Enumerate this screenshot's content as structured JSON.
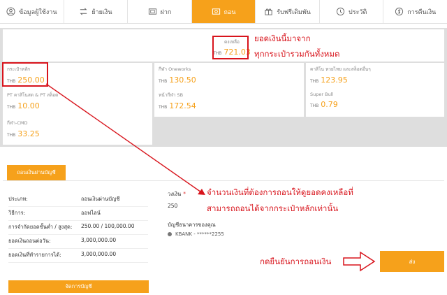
{
  "tabs": [
    {
      "label": "ข้อมูลผู้ใช้งาน",
      "icon": "user-icon",
      "active": false
    },
    {
      "label": "ย้ายเงิน",
      "icon": "transfer-icon",
      "active": false
    },
    {
      "label": "ฝาก",
      "icon": "deposit-icon",
      "active": false
    },
    {
      "label": "ถอน",
      "icon": "withdraw-icon",
      "active": true
    },
    {
      "label": "รับฟรีเดิมพัน",
      "icon": "gift-icon",
      "active": false
    },
    {
      "label": "ประวัติ",
      "icon": "history-icon",
      "active": false
    },
    {
      "label": "การคืนเงิน",
      "icon": "refund-icon",
      "active": false
    }
  ],
  "total": {
    "label": "คงเหลือ",
    "currency": "THB",
    "amount": "721.03"
  },
  "wallets": [
    {
      "name": "กระเป๋าหลัก",
      "currency": "THB",
      "amount": "250.00"
    },
    {
      "name": "กีฬา Oneworks",
      "currency": "THB",
      "amount": "130.50"
    },
    {
      "name": "คาสิโน หวยไทย และสล็อตอื่นๆ",
      "currency": "THB",
      "amount": "123.95"
    },
    {
      "name": "PT คาสิโนสด & PT สล็อต",
      "currency": "THB",
      "amount": "10.00"
    },
    {
      "name": "หน้ากีฬา SB",
      "currency": "THB",
      "amount": "172.54"
    },
    {
      "name": "Super Bull",
      "currency": "THB",
      "amount": "0.79"
    },
    {
      "name": "กีฬา-CMD",
      "currency": "THB",
      "amount": "33.25"
    }
  ],
  "panel": {
    "tab_label": "ถอนเงินผ่านบัญชี",
    "rows": [
      {
        "key": "ประเภท:",
        "value": "ถอนเงินผ่านบัญชี"
      },
      {
        "key": "วิธีการ:",
        "value": "ออฟไลน์"
      },
      {
        "key": "การจำกัดยอดขั้นต่ำ / สูงสุด:",
        "value": "250.00 / 100,000.00"
      },
      {
        "key": "ยอดเงินถอนต่อวัน:",
        "value": "3,000,000.00"
      },
      {
        "key": "ยอดเงินที่ทำรายการได้:",
        "value": "3,000,000.00"
      }
    ],
    "list_button": "จัดการบัญชี",
    "amount_label": "วงเงิน",
    "amount_required": "*",
    "amount_value": "250",
    "bank_label": "บัญชีธนาคารของคุณ",
    "bank_option": "KBANK - ******2255",
    "send_button": "ส่ง"
  },
  "annotations": {
    "total_note_1": "ยอดเงินนี้มาจาก",
    "total_note_2": "ทุกกระเป๋ารวมกันทั้งหมด",
    "amount_note_1": "จำนวนเงินที่ต้องการถอนให้ดูยอดคงเหลือที่",
    "amount_note_2": "สามารถถอนได้จากกระเป๋าหลักเท่านั้น",
    "send_note": "กดยืนยันการถอนเงิน"
  },
  "colors": {
    "accent": "#f6a11b",
    "annotation": "#d8141c"
  }
}
